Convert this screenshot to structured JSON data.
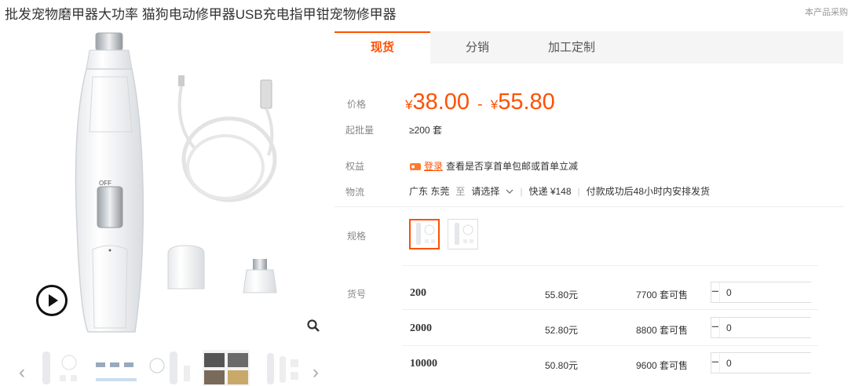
{
  "product": {
    "title": "批发宠物磨甲器大功率 猫狗电动修甲器USB充电指甲钳宠物修甲器",
    "top_note": "本产品采购"
  },
  "tabs": [
    {
      "label": "现货",
      "active": true
    },
    {
      "label": "分销",
      "active": false
    },
    {
      "label": "加工定制",
      "active": false
    }
  ],
  "price": {
    "label": "价格",
    "currency": "¥",
    "low": "38.00",
    "separator": "-",
    "high": "55.80"
  },
  "min_batch": {
    "label": "起批量",
    "value": "≥200 套"
  },
  "benefits": {
    "label": "权益",
    "login_text": "登录",
    "text": "查看是否享首单包邮或首单立减"
  },
  "logistics": {
    "label": "物流",
    "from": "广东 东莞",
    "to_word": "至",
    "destination": "请选择",
    "express": "快递 ¥148",
    "shipping_note": "付款成功后48小时内安排发货"
  },
  "spec": {
    "label": "规格"
  },
  "sku": {
    "label": "货号",
    "rows": [
      {
        "code": "200",
        "price": "55.80元",
        "stock": "7700 套可售",
        "qty": "0"
      },
      {
        "code": "2000",
        "price": "52.80元",
        "stock": "8800 套可售",
        "qty": "0"
      },
      {
        "code": "10000",
        "price": "50.80元",
        "stock": "9600 套可售",
        "qty": "0"
      }
    ]
  },
  "colors": {
    "accent": "#ff5000"
  },
  "icons": {
    "play": "play-icon",
    "zoom": "magnifier-icon",
    "prev": "chevron-left-icon",
    "next": "chevron-right-icon",
    "coupon": "coupon-icon",
    "dropdown": "chevron-down-icon"
  }
}
